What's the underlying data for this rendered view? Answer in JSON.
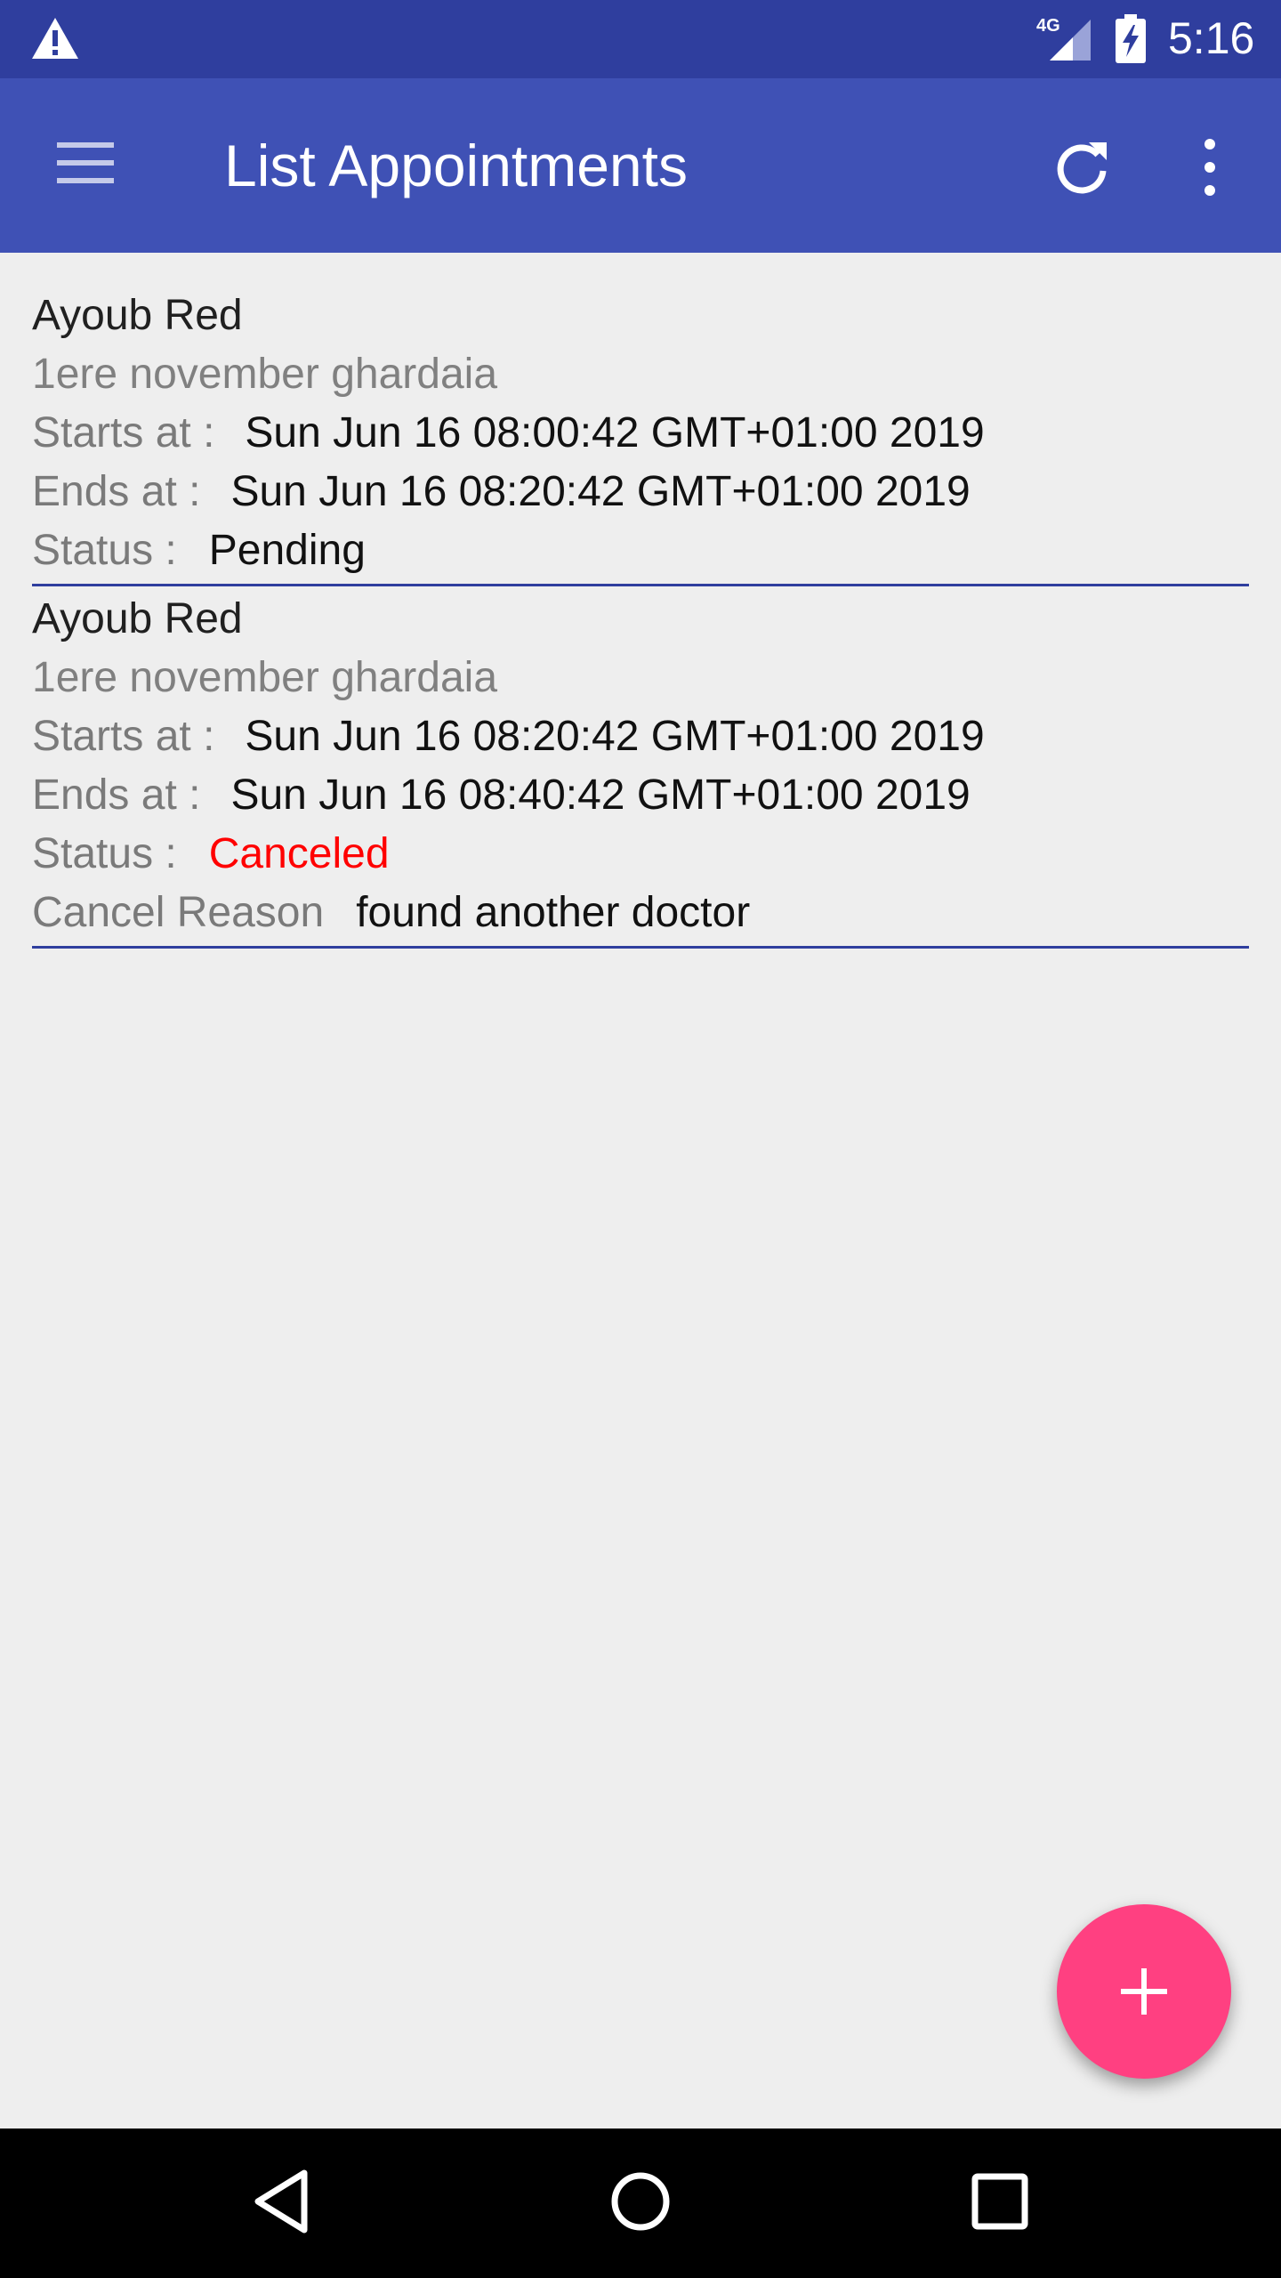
{
  "status_bar": {
    "network_label": "4G",
    "time": "5:16",
    "icons": [
      "warning-icon",
      "signal-icon",
      "battery-charging-icon"
    ]
  },
  "app_bar": {
    "title": "List Appointments",
    "icons": [
      "menu-icon",
      "refresh-icon",
      "more-vert-icon"
    ]
  },
  "appointments": [
    {
      "name": "Ayoub Red",
      "address": "1ere november ghardaia",
      "starts_label": "Starts at :",
      "starts_value": "Sun Jun 16 08:00:42 GMT+01:00 2019",
      "ends_label": "Ends at :",
      "ends_value": "Sun Jun 16 08:20:42 GMT+01:00 2019",
      "status_label": "Status :",
      "status_value": "Pending"
    },
    {
      "name": "Ayoub Red",
      "address": "1ere november ghardaia",
      "starts_label": "Starts at :",
      "starts_value": "Sun Jun 16 08:20:42 GMT+01:00 2019",
      "ends_label": "Ends at :",
      "ends_value": "Sun Jun 16 08:40:42 GMT+01:00 2019",
      "status_label": "Status :",
      "status_value": "Canceled",
      "cancel_reason_label": "Cancel Reason",
      "cancel_reason_value": "found another doctor"
    }
  ],
  "fab": {
    "icon": "plus-icon"
  },
  "nav_bar": {
    "icons": [
      "back-icon",
      "home-icon",
      "recents-icon"
    ]
  },
  "colors": {
    "status_bar": "#2f3e9e",
    "app_bar": "#3f51b5",
    "background": "#eeeeee",
    "divider": "#2f3e9e",
    "canceled": "#ff0000",
    "fab": "#ff4081"
  }
}
